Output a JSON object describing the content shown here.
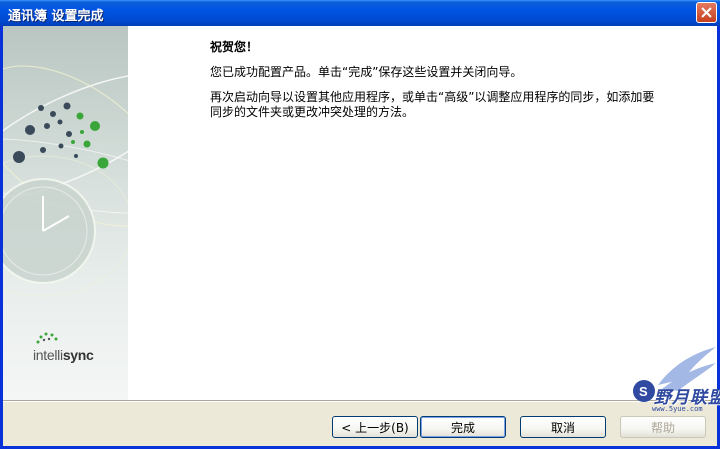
{
  "window": {
    "title": "通讯簿  设置完成"
  },
  "content": {
    "heading": "祝贺您！",
    "paragraph1": "您已成功配置产品。单击“完成”保存这些设置并关闭向导。",
    "paragraph2": "再次启动向导以设置其他应用程序，或单击“高级”以调整应用程序的同步，如添加要同步的文件夹或更改冲突处理的方法。"
  },
  "sidebar": {
    "logo_text_thin": "intelli",
    "logo_text_bold": "sync"
  },
  "buttons": {
    "back": "< 上一步(B)",
    "finish": "完成",
    "cancel": "取消",
    "help": "帮助"
  },
  "watermark": {
    "text": "野月联盟",
    "url": "www.5yue.com"
  },
  "colors": {
    "titlebar": "#0054e3",
    "accent_green": "#3aa63a",
    "dialog_bg": "#ece9d8"
  },
  "icons": {
    "close": "close-icon",
    "logo": "intellisync-logo",
    "watermark_wings": "wings-icon"
  }
}
